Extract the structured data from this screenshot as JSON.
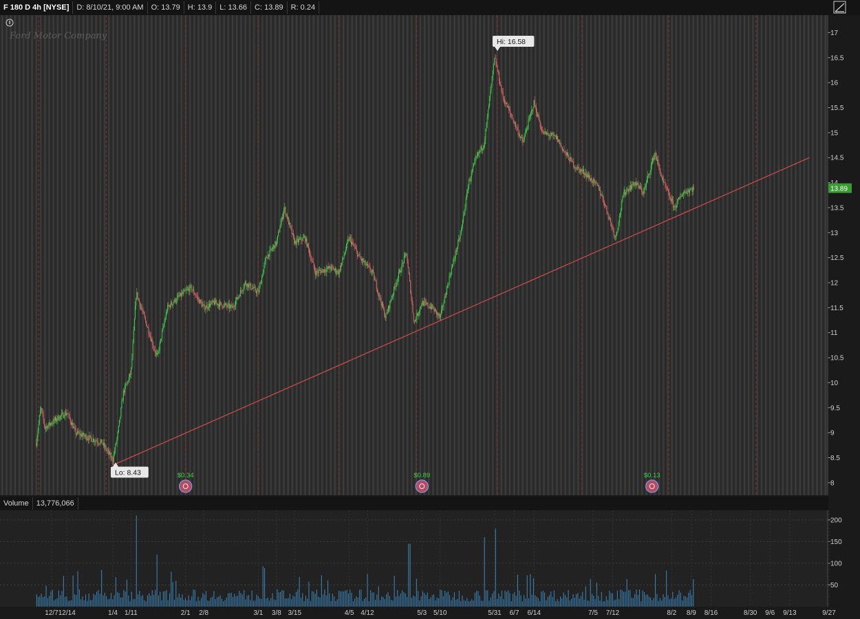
{
  "header": {
    "symbol": "F 180 D 4h [NYSE]",
    "date": "D: 8/10/21, 9:00 AM",
    "open": "O: 13.79",
    "high": "H: 13.9",
    "low": "L: 13.66",
    "close": "C: 13.89",
    "range": "R: 0.24"
  },
  "watermark": "Ford Motor Company",
  "volume_header": {
    "label": "Volume",
    "value": "13,776,066"
  },
  "colors": {
    "up": "#3fd14a",
    "down": "#e06868",
    "trend": "#c84a4a",
    "volume": "#3b7fb0",
    "price_tag": "#3c9a32"
  },
  "chart_data": [
    {
      "type": "candlestick",
      "y_ticks": [
        8,
        8.5,
        9,
        9.5,
        10,
        10.5,
        11,
        11.5,
        12,
        12.5,
        13,
        13.5,
        14,
        14.5,
        15,
        15.5,
        16,
        16.5,
        17
      ],
      "ylim": [
        7.75,
        17.35
      ],
      "x_ticks": [
        "12/7",
        "12/14",
        "1/4",
        "1/11",
        "2/1",
        "2/8",
        "3/1",
        "3/8",
        "3/15",
        "4/5",
        "4/12",
        "5/3",
        "5/10",
        "5/31",
        "6/7",
        "6/14",
        "7/5",
        "7/12",
        "8/2",
        "8/9",
        "8/16",
        "8/30",
        "9/6",
        "9/13",
        "9/27"
      ],
      "price_path": [
        [
          "11/30",
          8.8
        ],
        [
          "12/2",
          9.5
        ],
        [
          "12/4",
          9.1
        ],
        [
          "12/10",
          9.3
        ],
        [
          "12/14",
          9.4
        ],
        [
          "12/18",
          9.0
        ],
        [
          "12/24",
          8.9
        ],
        [
          "12/30",
          8.8
        ],
        [
          "1/4",
          8.45
        ],
        [
          "1/6",
          9.0
        ],
        [
          "1/8",
          9.8
        ],
        [
          "1/11",
          10.2
        ],
        [
          "1/13",
          11.8
        ],
        [
          "1/18",
          11.0
        ],
        [
          "1/21",
          10.5
        ],
        [
          "1/25",
          11.5
        ],
        [
          "1/29",
          11.7
        ],
        [
          "2/3",
          11.9
        ],
        [
          "2/8",
          11.5
        ],
        [
          "2/12",
          11.6
        ],
        [
          "2/19",
          11.5
        ],
        [
          "2/24",
          12.0
        ],
        [
          "3/1",
          11.8
        ],
        [
          "3/4",
          12.5
        ],
        [
          "3/8",
          12.8
        ],
        [
          "3/11",
          13.5
        ],
        [
          "3/15",
          12.8
        ],
        [
          "3/19",
          12.9
        ],
        [
          "3/23",
          12.2
        ],
        [
          "3/29",
          12.3
        ],
        [
          "4/1",
          12.2
        ],
        [
          "4/5",
          12.9
        ],
        [
          "4/9",
          12.5
        ],
        [
          "4/14",
          12.2
        ],
        [
          "4/19",
          11.3
        ],
        [
          "4/23",
          12.0
        ],
        [
          "4/27",
          12.6
        ],
        [
          "4/30",
          11.2
        ],
        [
          "5/3",
          11.6
        ],
        [
          "5/7",
          11.5
        ],
        [
          "5/10",
          11.3
        ],
        [
          "5/14",
          12.2
        ],
        [
          "5/18",
          13.0
        ],
        [
          "5/21",
          14.0
        ],
        [
          "5/24",
          14.5
        ],
        [
          "5/27",
          14.8
        ],
        [
          "5/31",
          16.5
        ],
        [
          "6/3",
          15.7
        ],
        [
          "6/7",
          15.2
        ],
        [
          "6/10",
          14.8
        ],
        [
          "6/14",
          15.6
        ],
        [
          "6/17",
          15.0
        ],
        [
          "6/22",
          14.9
        ],
        [
          "6/25",
          14.6
        ],
        [
          "6/29",
          14.3
        ],
        [
          "7/2",
          14.2
        ],
        [
          "7/7",
          13.9
        ],
        [
          "7/9",
          13.6
        ],
        [
          "7/13",
          12.9
        ],
        [
          "7/16",
          13.8
        ],
        [
          "7/20",
          14.0
        ],
        [
          "7/23",
          13.8
        ],
        [
          "7/27",
          14.6
        ],
        [
          "7/30",
          14.0
        ],
        [
          "8/3",
          13.5
        ],
        [
          "8/6",
          13.8
        ],
        [
          "8/10",
          13.89
        ]
      ],
      "annotations": [
        {
          "label": "Hi: 16.58",
          "date": "5/31",
          "value": 16.58
        },
        {
          "label": "Lo: 8.43",
          "date": "1/4",
          "value": 8.43
        }
      ],
      "trend_line": {
        "start": [
          "1/4",
          8.35
        ],
        "end": [
          "9/20",
          14.5
        ]
      },
      "last_price": "13.89",
      "dividends": [
        {
          "label": "$0.34",
          "date": "2/1"
        },
        {
          "label": "$0.89",
          "date": "5/3"
        },
        {
          "label": "$0.13",
          "date": "7/26"
        }
      ]
    },
    {
      "type": "bar",
      "series": "Volume",
      "y_ticks": [
        50,
        100,
        150,
        200
      ],
      "ylim": [
        0,
        222
      ],
      "spikes": [
        [
          "1/13",
          210
        ],
        [
          "1/21",
          120
        ],
        [
          "4/28",
          145
        ],
        [
          "5/27",
          160
        ],
        [
          "5/31",
          180
        ],
        [
          "7/27",
          75
        ]
      ]
    }
  ]
}
